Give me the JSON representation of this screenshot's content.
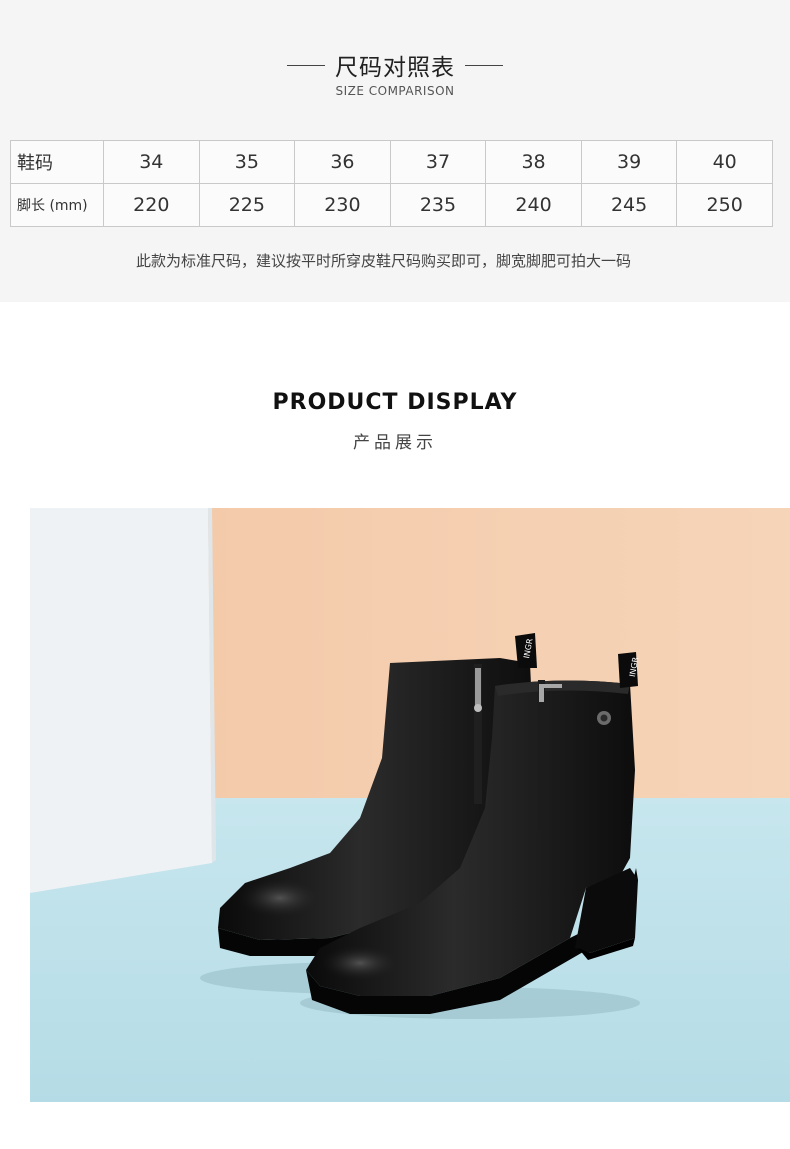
{
  "size_chart": {
    "title_cn": "尺码对照表",
    "title_en": "SIZE COMPARISON",
    "rows": [
      {
        "label": "鞋码",
        "values": [
          "34",
          "35",
          "36",
          "37",
          "38",
          "39",
          "40"
        ]
      },
      {
        "label": "脚长 (mm)",
        "values": [
          "220",
          "225",
          "230",
          "235",
          "240",
          "245",
          "250"
        ]
      }
    ],
    "note": "此款为标准尺码，建议按平时所穿皮鞋尺码购买即可，脚宽脚肥可拍大一码"
  },
  "product_display": {
    "title_en": "PRODUCT DISPLAY",
    "title_cn": "产品展示",
    "tag_text": "INGR"
  },
  "colors": {
    "section_bg": "#f5f5f5",
    "wall": "#f1c9a8",
    "floor": "#bfe2ea",
    "panel": "#eef2f5",
    "leather": "#141414"
  }
}
